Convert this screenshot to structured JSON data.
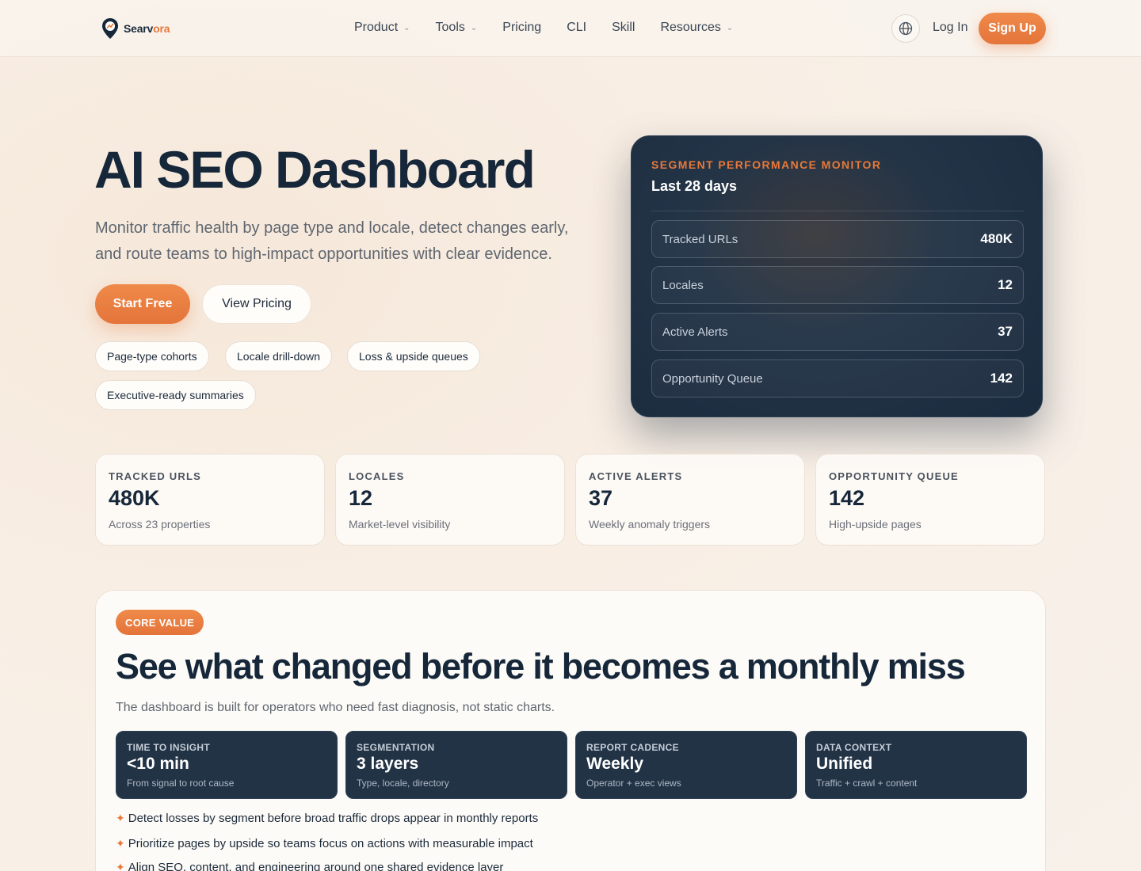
{
  "brand": {
    "name_a": "Searv",
    "name_b": "ora",
    "accent": "#e8793a",
    "dark": "#16273a"
  },
  "nav": {
    "items": [
      {
        "label": "Product",
        "dropdown": true
      },
      {
        "label": "Tools",
        "dropdown": true
      },
      {
        "label": "Pricing",
        "dropdown": false
      },
      {
        "label": "CLI",
        "dropdown": false
      },
      {
        "label": "Skill",
        "dropdown": false
      },
      {
        "label": "Resources",
        "dropdown": true
      }
    ],
    "login": "Log In",
    "signup": "Sign Up"
  },
  "hero": {
    "title": "AI SEO Dashboard",
    "subtitle": "Monitor traffic health by page type and locale, detect changes early, and route teams to high-impact opportunities with clear evidence.",
    "cta_primary": "Start Free",
    "cta_secondary": "View Pricing",
    "chips": [
      "Page-type cohorts",
      "Locale drill-down",
      "Loss & upside queues",
      "Executive-ready summaries"
    ]
  },
  "monitor": {
    "kicker": "SEGMENT PERFORMANCE MONITOR",
    "title": "Last 28 days",
    "rows": [
      {
        "label": "Tracked URLs",
        "value": "480K"
      },
      {
        "label": "Locales",
        "value": "12"
      },
      {
        "label": "Active Alerts",
        "value": "37"
      },
      {
        "label": "Opportunity Queue",
        "value": "142"
      }
    ]
  },
  "stats": [
    {
      "key": "TRACKED URLS",
      "value": "480K",
      "desc": "Across 23 properties"
    },
    {
      "key": "LOCALES",
      "value": "12",
      "desc": "Market-level visibility"
    },
    {
      "key": "ACTIVE ALERTS",
      "value": "37",
      "desc": "Weekly anomaly triggers"
    },
    {
      "key": "OPPORTUNITY QUEUE",
      "value": "142",
      "desc": "High-upside pages"
    }
  ],
  "core": {
    "badge": "CORE VALUE",
    "title": "See what changed before it becomes a monthly miss",
    "subtitle": "The dashboard is built for operators who need fast diagnosis, not static charts.",
    "cards": [
      {
        "key": "TIME TO INSIGHT",
        "value": "<10 min",
        "desc": "From signal to root cause"
      },
      {
        "key": "SEGMENTATION",
        "value": "3 layers",
        "desc": "Type, locale, directory"
      },
      {
        "key": "REPORT CADENCE",
        "value": "Weekly",
        "desc": "Operator + exec views"
      },
      {
        "key": "DATA CONTEXT",
        "value": "Unified",
        "desc": "Traffic + crawl + content"
      }
    ],
    "bullets": [
      "Detect losses by segment before broad traffic drops appear in monthly reports",
      "Prioritize pages by upside so teams focus on actions with measurable impact",
      "Align SEO, content, and engineering around one shared evidence layer"
    ]
  }
}
